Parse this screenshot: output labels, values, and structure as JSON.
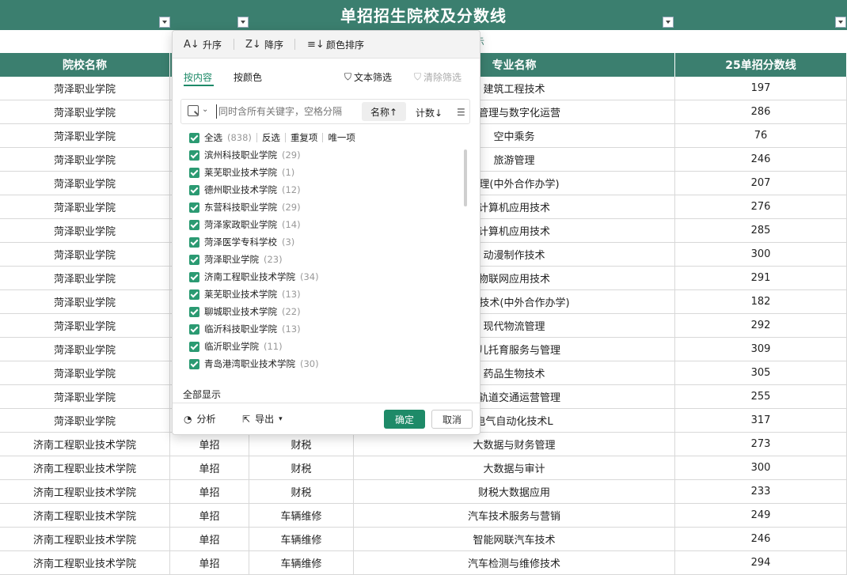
{
  "sheet": {
    "title": "单招招生院校及分数线",
    "sub_link": "示",
    "columns": [
      "院校名称",
      "",
      "",
      "专业名称",
      "25单招分数线"
    ],
    "rows": [
      [
        "菏泽职业学院",
        "",
        "",
        "建筑工程技术",
        "197"
      ],
      [
        "菏泽职业学院",
        "",
        "",
        "店管理与数字化运营",
        "286"
      ],
      [
        "菏泽职业学院",
        "",
        "",
        "空中乘务",
        "76"
      ],
      [
        "菏泽职业学院",
        "",
        "",
        "旅游管理",
        "246"
      ],
      [
        "菏泽职业学院",
        "",
        "",
        "管理(中外合作办学)",
        "207"
      ],
      [
        "菏泽职业学院",
        "",
        "",
        "计算机应用技术",
        "276"
      ],
      [
        "菏泽职业学院",
        "",
        "",
        "计算机应用技术",
        "285"
      ],
      [
        "菏泽职业学院",
        "",
        "",
        "动漫制作技术",
        "300"
      ],
      [
        "菏泽职业学院",
        "",
        "",
        "物联网应用技术",
        "291"
      ],
      [
        "菏泽职业学院",
        "",
        "",
        "应用技术(中外合作办学)",
        "182"
      ],
      [
        "菏泽职业学院",
        "",
        "",
        "现代物流管理",
        "292"
      ],
      [
        "菏泽职业学院",
        "",
        "",
        "幼儿托育服务与管理",
        "309"
      ],
      [
        "菏泽职业学院",
        "",
        "",
        "药品生物技术",
        "305"
      ],
      [
        "菏泽职业学院",
        "",
        "",
        "市轨道交通运营管理",
        "255"
      ],
      [
        "菏泽职业学院",
        "",
        "",
        "电气自动化技术L",
        "317"
      ],
      [
        "济南工程职业技术学院",
        "单招",
        "财税",
        "大数据与财务管理",
        "273"
      ],
      [
        "济南工程职业技术学院",
        "单招",
        "财税",
        "大数据与审计",
        "300"
      ],
      [
        "济南工程职业技术学院",
        "单招",
        "财税",
        "财税大数据应用",
        "233"
      ],
      [
        "济南工程职业技术学院",
        "单招",
        "车辆维修",
        "汽车技术服务与营销",
        "249"
      ],
      [
        "济南工程职业技术学院",
        "单招",
        "车辆维修",
        "智能网联汽车技术",
        "246"
      ],
      [
        "济南工程职业技术学院",
        "单招",
        "车辆维修",
        "汽车检测与维修技术",
        "294"
      ]
    ]
  },
  "filter": {
    "sort_asc": "升序",
    "sort_desc": "降序",
    "sort_color": "颜色排序",
    "tab_content": "按内容",
    "tab_color": "按颜色",
    "text_filter": "文本筛选",
    "clear_filter": "清除筛选",
    "search_placeholder": "同时含所有关键字，空格分隔",
    "sort_by_name": "名称↑",
    "sort_by_count": "计数↓",
    "select_all": "全选",
    "select_all_count": "(838)",
    "invert": "反选",
    "duplicates": "重复项",
    "unique": "唯一项",
    "items": [
      {
        "name": "滨州科技职业学院",
        "count": "(29)"
      },
      {
        "name": "莱芜职业技术学院",
        "count": "(1)"
      },
      {
        "name": "德州职业技术学院",
        "count": "(12)"
      },
      {
        "name": "东营科技职业学院",
        "count": "(29)"
      },
      {
        "name": "菏泽家政职业学院",
        "count": "(14)"
      },
      {
        "name": "菏泽医学专科学校",
        "count": "(3)"
      },
      {
        "name": "菏泽职业学院",
        "count": "(23)"
      },
      {
        "name": "济南工程职业技术学院",
        "count": "(34)"
      },
      {
        "name": "莱芜职业技术学院",
        "count": "(13)"
      },
      {
        "name": "聊城职业技术学院",
        "count": "(22)"
      },
      {
        "name": "临沂科技职业学院",
        "count": "(13)"
      },
      {
        "name": "临沂职业学院",
        "count": "(11)"
      },
      {
        "name": "青岛港湾职业技术学院",
        "count": "(30)"
      }
    ],
    "show_all": "全部显示",
    "analyze": "分析",
    "export": "导出",
    "ok": "确定",
    "cancel": "取消"
  },
  "colors": {
    "header_green": "#3b7f6f",
    "accent_green": "#1e8a68"
  }
}
